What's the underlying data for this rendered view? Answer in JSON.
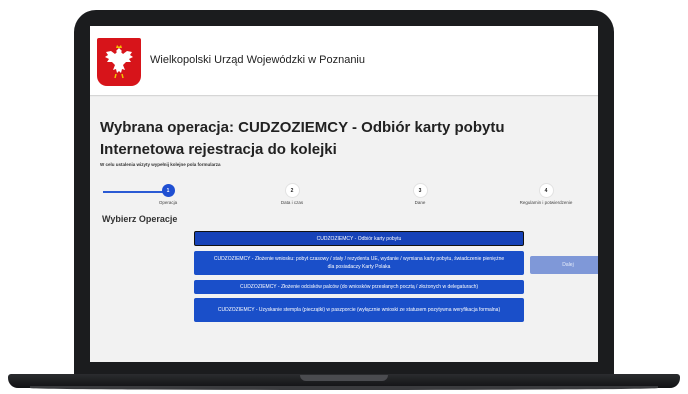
{
  "header": {
    "title": "Wielkopolski Urząd Wojewódzki w Poznaniu",
    "emblem_icon": "polish-eagle-emblem-icon",
    "emblem_color": "#d7141a"
  },
  "main": {
    "operation_title": "Wybrana operacja: CUDZOZIEMCY - Odbiór karty pobytu",
    "registration_title": "Internetowa rejestracja do kolejki",
    "hint": "W celu ustalenia wizyty wypełnij kolejne pola formularza",
    "choose_title": "Wybierz Operacje",
    "next_label": "Dalej"
  },
  "stepper": {
    "active_step": 1,
    "accent": "#1f4fd2",
    "steps": [
      {
        "number": "1",
        "label": "Operacja"
      },
      {
        "number": "2",
        "label": "Data i czas"
      },
      {
        "number": "3",
        "label": "Dane"
      },
      {
        "number": "4",
        "label": "Regulamin i potwierdzenie"
      }
    ]
  },
  "operations": [
    {
      "label": "CUDZOZIEMCY - Odbiór karty pobytu",
      "selected": true
    },
    {
      "label": "CUDZOZIEMCY - Złożenie wniosku: pobyt czasowy / stały / rezydenta UE, wydanie / wymiana karty pobytu, świadczenie pieniężne dla posiadaczy Karty Polaka",
      "selected": false
    },
    {
      "label": "CUDZOZIEMCY - Złożenie odcisków palców (do wniosków przesłanych pocztą / złożonych w delegaturach)",
      "selected": false
    },
    {
      "label": "CUDZOZIEMCY - Uzyskanie stempla (pieczątki) w paszporcie (wyłącznie wnioski ze statusem pozytywna weryfikacja formalna)",
      "selected": false
    }
  ],
  "colors": {
    "operation_button": "#1a4fc9",
    "next_button": "#7f98d8"
  }
}
